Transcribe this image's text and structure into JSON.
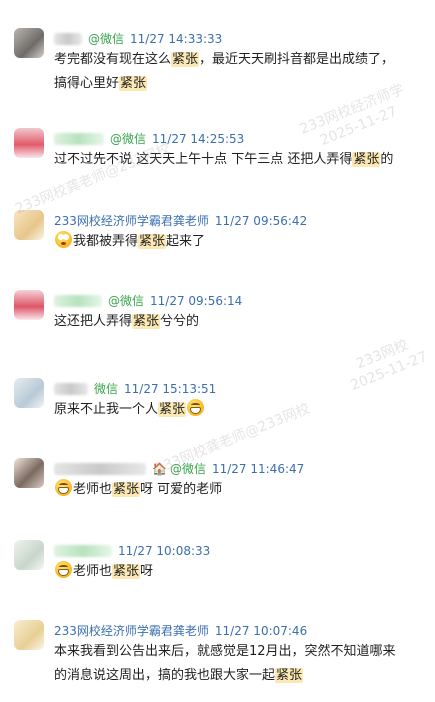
{
  "comments": [
    {
      "source": "@微信",
      "time": "11/27 14:33:33",
      "line1_a": "考完都没有现在这么",
      "line1_hl": "紧张",
      "line1_b": "，最近天天刷抖音都是出成绩了，",
      "line2_a": "搞得心里好",
      "line2_hl": "紧张"
    },
    {
      "source": "@微信",
      "time": "11/27 14:25:53",
      "text_a": "过不过先不说 这天天上午十点 下午三点 还把人弄得",
      "text_hl": "紧张",
      "text_b": "的"
    },
    {
      "author": "233网校经济师学霸君龚老师",
      "time": "11/27 09:56:42",
      "emoji": "flushed-face",
      "text_a": "我都被弄得",
      "text_hl": "紧张",
      "text_b": "起来了"
    },
    {
      "source": "@微信",
      "time": "11/27 09:56:14",
      "text_a": "这还把人弄得",
      "text_hl": "紧张",
      "text_b": "兮兮的"
    },
    {
      "source": "微信",
      "time": "11/27 15:13:51",
      "text_a": "原来不止我一个人",
      "text_hl": "紧张",
      "emoji": "grinning-face"
    },
    {
      "source": "@微信",
      "time": "11/27 11:46:47",
      "emoji": "grinning-face",
      "text_a": "老师也",
      "text_hl": "紧张",
      "text_b": "呀 可爱的老师"
    },
    {
      "time": "11/27 10:08:33",
      "emoji": "grinning-face",
      "text_a": "老师也",
      "text_hl": "紧张",
      "text_b": "呀"
    },
    {
      "author": "233网校经济师学霸君龚老师",
      "time": "11/27 10:07:46",
      "line1": "本来我看到公告出来后，就感觉是12月出，突然不知道哪来",
      "line2_a": "的消息说这周出，搞的我也跟大家一起",
      "line2_hl": "紧张"
    }
  ],
  "watermarks": {
    "a": "233网校经济师学",
    "b": "2025-11-27",
    "c": "233网校龚老师@233网校",
    "d": "233网校",
    "e": "2025-11-27",
    "f": "233网校龚老师@233网校"
  },
  "colors": {
    "highlight": "#fbe8b2",
    "source_green": "#3aa34d",
    "meta_blue": "#3b6fb0"
  }
}
